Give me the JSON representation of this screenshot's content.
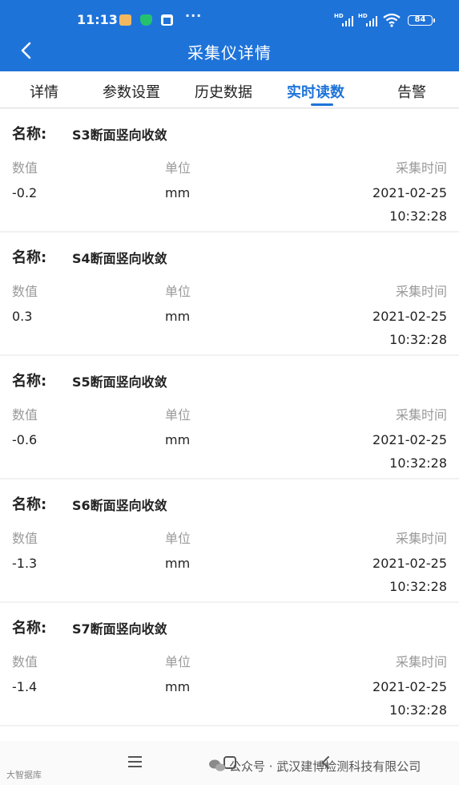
{
  "status_bar": {
    "time": "11:13",
    "dots": "···",
    "hd1": "HD",
    "hd2": "HD",
    "battery": "84"
  },
  "header": {
    "title": "采集仪详情"
  },
  "tabs": [
    {
      "label": "详情",
      "active": false
    },
    {
      "label": "参数设置",
      "active": false
    },
    {
      "label": "历史数据",
      "active": false
    },
    {
      "label": "实时读数",
      "active": true
    },
    {
      "label": "告警",
      "active": false
    }
  ],
  "cards": [
    {
      "name_label": "名称:",
      "name": "S3断面竖向收敛",
      "h_value": "数值",
      "h_unit": "单位",
      "h_time": "采集时间",
      "value": "-0.2",
      "unit": "mm",
      "date": "2021-02-25",
      "time": "10:32:28"
    },
    {
      "name_label": "名称:",
      "name": "S4断面竖向收敛",
      "h_value": "数值",
      "h_unit": "单位",
      "h_time": "采集时间",
      "value": "0.3",
      "unit": "mm",
      "date": "2021-02-25",
      "time": "10:32:28"
    },
    {
      "name_label": "名称:",
      "name": "S5断面竖向收敛",
      "h_value": "数值",
      "h_unit": "单位",
      "h_time": "采集时间",
      "value": "-0.6",
      "unit": "mm",
      "date": "2021-02-25",
      "time": "10:32:28"
    },
    {
      "name_label": "名称:",
      "name": "S6断面竖向收敛",
      "h_value": "数值",
      "h_unit": "单位",
      "h_time": "采集时间",
      "value": "-1.3",
      "unit": "mm",
      "date": "2021-02-25",
      "time": "10:32:28"
    },
    {
      "name_label": "名称:",
      "name": "S7断面竖向收敛",
      "h_value": "数值",
      "h_unit": "单位",
      "h_time": "采集时间",
      "value": "-1.4",
      "unit": "mm",
      "date": "2021-02-25",
      "time": "10:32:28"
    }
  ],
  "watermark": {
    "text": "公众号 · 武汉建博检测科技有限公司",
    "corner": "大智据库"
  },
  "colors": {
    "accent": "#1e73d9",
    "background": "#f0f1f3",
    "header_text": "#ffffff",
    "muted": "#9a9a9a"
  },
  "icons": [
    "back-arrow-icon",
    "notification-icon",
    "shield-icon",
    "app-icon",
    "signal-icon",
    "wifi-icon",
    "battery-icon",
    "menu-icon",
    "home-icon",
    "nav-back-icon",
    "wechat-icon"
  ]
}
